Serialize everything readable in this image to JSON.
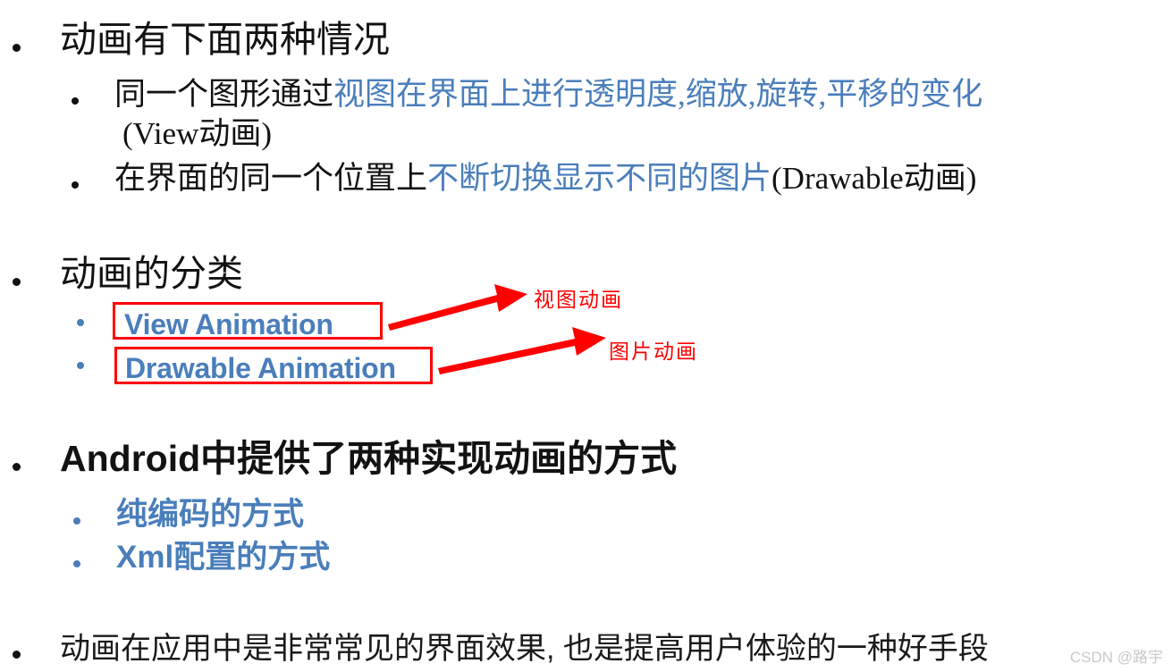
{
  "slide": {
    "background_color": "#ffffff",
    "accent_blue": "#4a7ebb",
    "annotation_red": "#ff0000",
    "text_black": "#121212"
  },
  "sections": [
    {
      "id": "animation-cases",
      "heading": "动画有下面两种情况",
      "items": [
        {
          "id": "view-animation-case",
          "line1_black_prefix": "同一个图形通过",
          "line1_blue": "视图在界面上进行透明度,缩放,旋转,平移的变化",
          "line2_black": "(View动画)"
        },
        {
          "id": "drawable-animation-case",
          "line1_black_prefix": "在界面的同一个位置上",
          "line1_blue": "不断切换显示不同的图片",
          "line1_black_suffix": "(Drawable动画)"
        }
      ]
    },
    {
      "id": "animation-classification",
      "heading": "动画的分类",
      "items": [
        {
          "id": "view-animation",
          "label": "View Animation",
          "boxed": true
        },
        {
          "id": "drawable-animation",
          "label": "Drawable Animation",
          "boxed": true
        }
      ]
    },
    {
      "id": "android-implementation",
      "heading_bold": "Android",
      "heading_rest": "中提供了两种实现动画的方式",
      "items": [
        {
          "id": "pure-code",
          "label": "纯编码的方式"
        },
        {
          "id": "xml-config",
          "label": "Xml配置的方式"
        }
      ]
    },
    {
      "id": "closing-note",
      "heading": "动画在应用中是非常常见的界面效果, 也是提高用户体验的一种好手段"
    }
  ],
  "annotations": [
    {
      "id": "view-animation-annotation",
      "label": "视图动画"
    },
    {
      "id": "drawable-animation-annotation",
      "label": "图片动画"
    }
  ],
  "watermark": {
    "text": "CSDN @路宇"
  }
}
